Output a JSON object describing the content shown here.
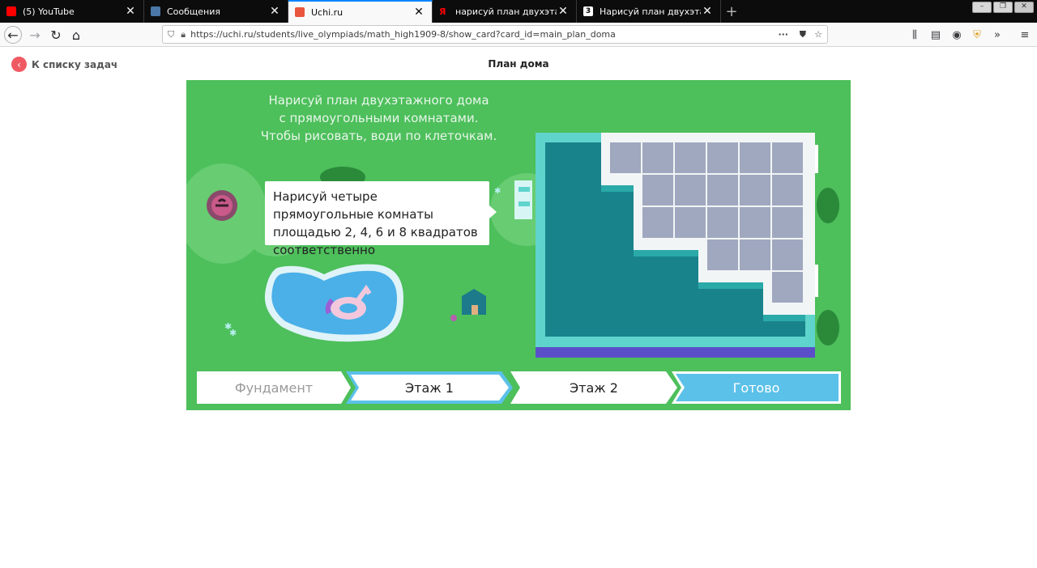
{
  "browser": {
    "tabs": [
      {
        "title": "(5) YouTube",
        "favicon_color": "#ff0000",
        "active": false
      },
      {
        "title": "Сообщения",
        "favicon_color": "#4a76a8",
        "active": false
      },
      {
        "title": "Uchi.ru",
        "favicon_color": "#e9563d",
        "active": true
      },
      {
        "title": "нарисуй план двухэтажного д",
        "favicon_color": "#ff0000",
        "active": false
      },
      {
        "title": "Нарисуй план двухэтажного д",
        "favicon_color": "#ffffff",
        "active": false
      }
    ],
    "url": "https://uchi.ru/students/live_olympiads/math_high1909-8/show_card?card_id=main_plan_doma"
  },
  "page": {
    "back_label": "К списку задач",
    "title": "План дома"
  },
  "game": {
    "instruction_lines": [
      "Нарисуй план двухэтажного дома",
      "с прямоугольными комнатами.",
      "Чтобы рисовать, води по клеточкам."
    ],
    "bubble_text": "Нарисуй четыре прямоугольные комнаты площадью 2, 4, 6 и 8 квадратов соответственно",
    "steps": [
      {
        "label": "Фундамент",
        "state": "done"
      },
      {
        "label": "Этаж 1",
        "state": "current"
      },
      {
        "label": "Этаж 2",
        "state": "upcoming"
      },
      {
        "label": "Готово",
        "state": "final"
      }
    ],
    "colors": {
      "grass": "#4dbf5b",
      "plan_dark": "#19838c",
      "plan_border": "#5fd4cc",
      "cell": "#a0a8bf",
      "done_button": "#5bc1e8"
    },
    "grid_rows": [
      [
        1,
        1,
        1,
        1,
        1,
        1
      ],
      [
        0,
        1,
        1,
        1,
        1,
        1
      ],
      [
        0,
        1,
        1,
        1,
        1,
        1
      ],
      [
        0,
        0,
        0,
        1,
        1,
        1
      ],
      [
        0,
        0,
        0,
        0,
        0,
        1
      ]
    ]
  }
}
